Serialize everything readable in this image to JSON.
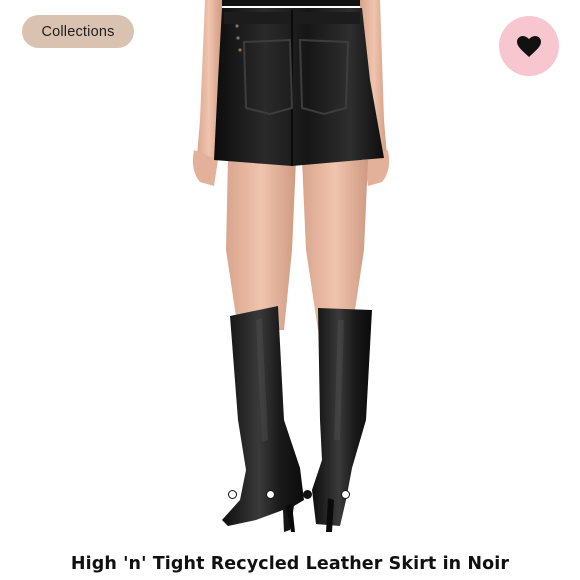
{
  "header": {
    "collections_label": "Collections",
    "favorite_icon": "heart-icon"
  },
  "colors": {
    "collections_bg": "#d9c3b0",
    "favorite_bg": "#f7c6cf",
    "text": "#111111"
  },
  "carousel": {
    "total_slides": 4,
    "active_slide": 3
  },
  "product": {
    "title": "High 'n' Tight Recycled Leather Skirt in Noir"
  }
}
